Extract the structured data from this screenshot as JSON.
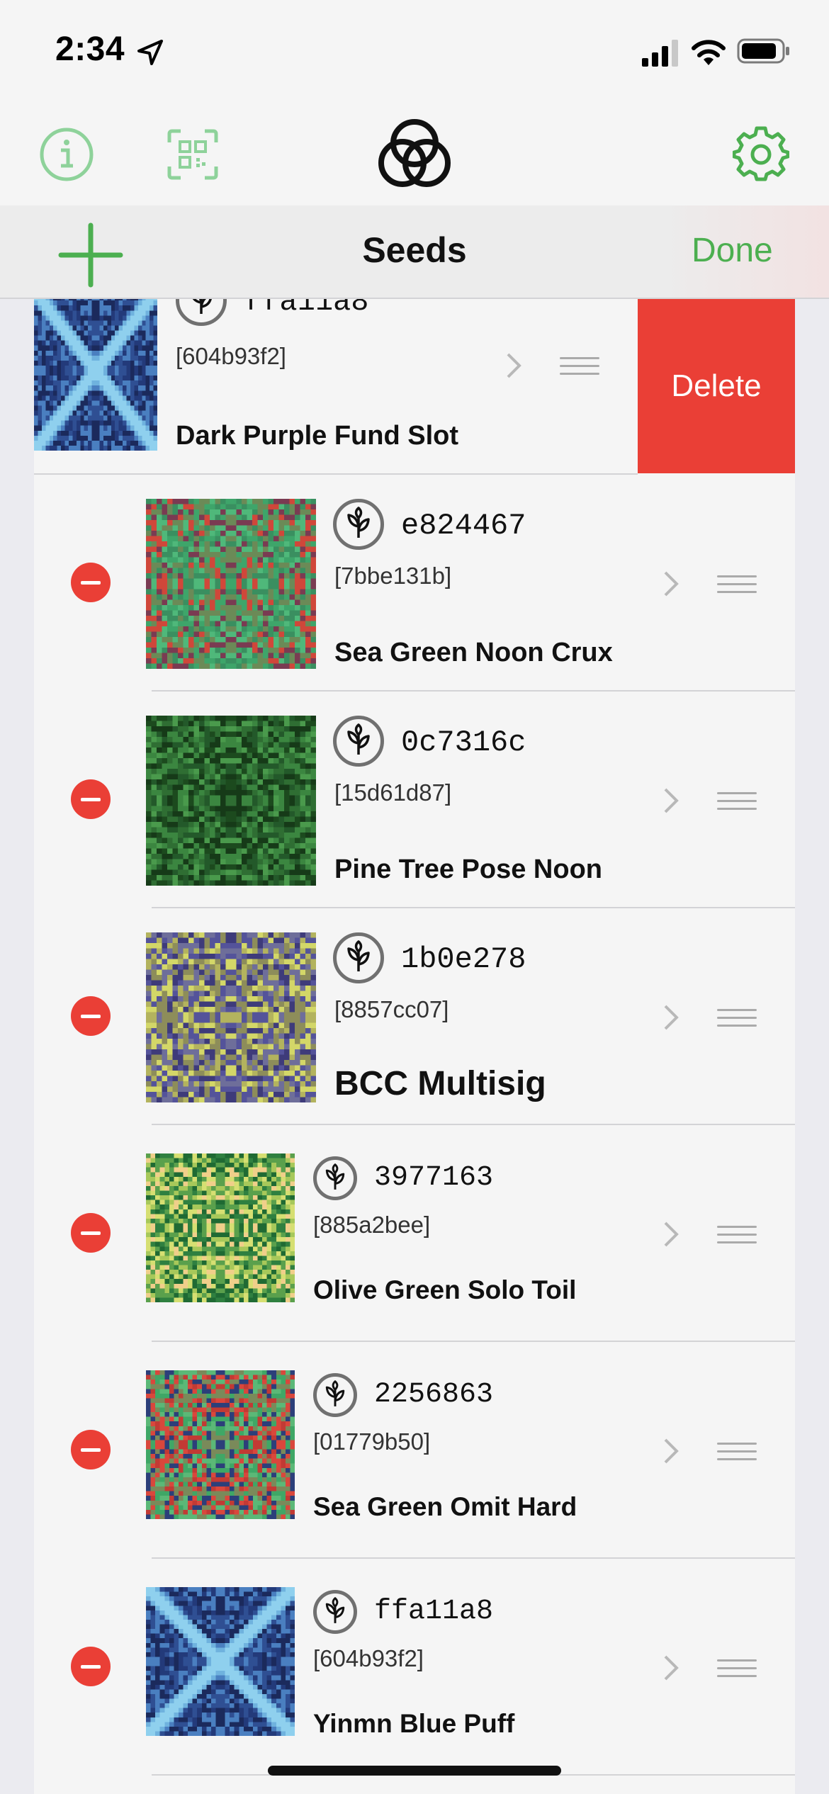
{
  "status_bar": {
    "time": "2:34"
  },
  "header": {
    "title": "Seeds",
    "done_label": "Done"
  },
  "colors": {
    "accent": "#4caf50",
    "destructive": "#ea3f36"
  },
  "swiped_row": {
    "id": "ffa11a8",
    "fingerprint": "[604b93f2]",
    "name": "Dark Purple Fund Slot",
    "delete_label": "Delete",
    "pattern": "blue"
  },
  "seeds": [
    {
      "id": "e824467",
      "fingerprint": "[7bbe131b]",
      "name": "Sea Green Noon Crux",
      "pattern": "seagreen"
    },
    {
      "id": "0c7316c",
      "fingerprint": "[15d61d87]",
      "name": "Pine Tree Pose Noon",
      "pattern": "pine"
    },
    {
      "id": "1b0e278",
      "fingerprint": "[8857cc07]",
      "name": "BCC Multisig",
      "pattern": "olive"
    },
    {
      "id": "3977163",
      "fingerprint": "[885a2bee]",
      "name": "Olive Green Solo Toil",
      "pattern": "lime"
    },
    {
      "id": "2256863",
      "fingerprint": "[01779b50]",
      "name": "Sea Green Omit Hard",
      "pattern": "red"
    },
    {
      "id": "ffa11a8",
      "fingerprint": "[604b93f2]",
      "name": "Yinmn Blue Puff",
      "pattern": "blue"
    }
  ]
}
